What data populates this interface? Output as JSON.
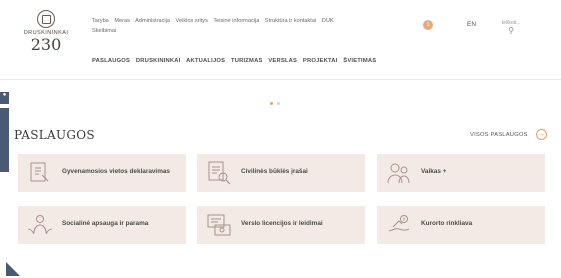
{
  "logo": {
    "name": "DRUSKININKAI",
    "year": "230"
  },
  "top_links": [
    "Taryba",
    "Meras",
    "Administracija",
    "Veiklos sritys",
    "Teisinė informacija",
    "Struktūra ir kontaktai",
    "DUK",
    "Skelbimai"
  ],
  "main_nav": [
    "PASLAUGOS",
    "DRUSKININKAI",
    "AKTUALIJOS",
    "TURIZMAS",
    "VERSLAS",
    "PROJEKTAI",
    "ŠVIETIMAS"
  ],
  "header": {
    "alert_count": "1",
    "language": "EN",
    "search_placeholder": "Ieškoti..."
  },
  "section": {
    "title": "PASLAUGOS",
    "all_link": "VISOS PASLAUGOS"
  },
  "services": [
    {
      "label": "Gyvenamosios vietos deklaravimas",
      "icon": "declaration-icon"
    },
    {
      "label": "Civilinės būklės įrašai",
      "icon": "document-search-icon"
    },
    {
      "label": "Vaikas +",
      "icon": "family-icon"
    },
    {
      "label": "Socialinė apsauga ir parama",
      "icon": "social-support-icon"
    },
    {
      "label": "Verslo licencijos ir leidimai",
      "icon": "license-icon"
    },
    {
      "label": "Kurorto rinkliava",
      "icon": "resort-fee-icon"
    }
  ],
  "colors": {
    "accent": "#e7a06a",
    "card_bg": "#f4eae5",
    "side_tab": "#4a5a75"
  }
}
